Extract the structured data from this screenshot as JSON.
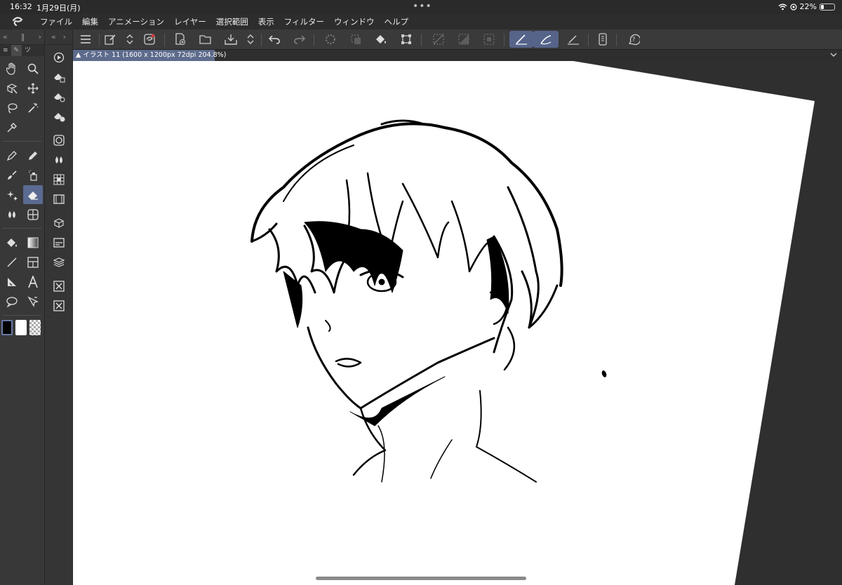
{
  "status": {
    "time": "16:32",
    "date": "1月29日(月)",
    "battery": "22%"
  },
  "menu": [
    "ファイル",
    "編集",
    "アニメーション",
    "レイヤー",
    "選択範囲",
    "表示",
    "フィルター",
    "ウィンドウ",
    "ヘルプ"
  ],
  "tool_palette": {
    "tabs": [
      "",
      "ツ"
    ],
    "active_tool": "eraser",
    "tools": [
      "hand",
      "zoom",
      "object",
      "move",
      "lasso-select",
      "auto-select",
      "eyedropper",
      "pen",
      "pencil",
      "brush",
      "airbrush",
      "decoration",
      "eraser",
      "blend",
      "frame-border",
      "fill",
      "gradient",
      "figure",
      "frame",
      "ruler",
      "text",
      "balloon",
      "correct-line"
    ]
  },
  "sub_tools": [
    "navigator",
    "layer-property-a",
    "layer-property-b",
    "layer-property-c",
    "tool-property",
    "color-wheel",
    "color-mixing",
    "color-set",
    "animation-timeline",
    "material",
    "layer",
    "layer-search",
    "close-a",
    "close-b"
  ],
  "command_bar": {
    "active": [
      "snap-to-ruler",
      "snap-to-special-ruler"
    ],
    "dim": [
      "redo",
      "deselect-area",
      "clear",
      "fill-selection",
      "show-selection",
      "hide-ruler-edit"
    ]
  },
  "document": {
    "tab_label": "イラスト 11 (1600 x 1200px 72dpi 204.8%)"
  },
  "colors": {
    "accent": "#5d6b8c",
    "active_tool": "#5a6a92",
    "panel": "#383838",
    "canvas_bg": "#2f2f2f",
    "paper": "#ffffff"
  }
}
